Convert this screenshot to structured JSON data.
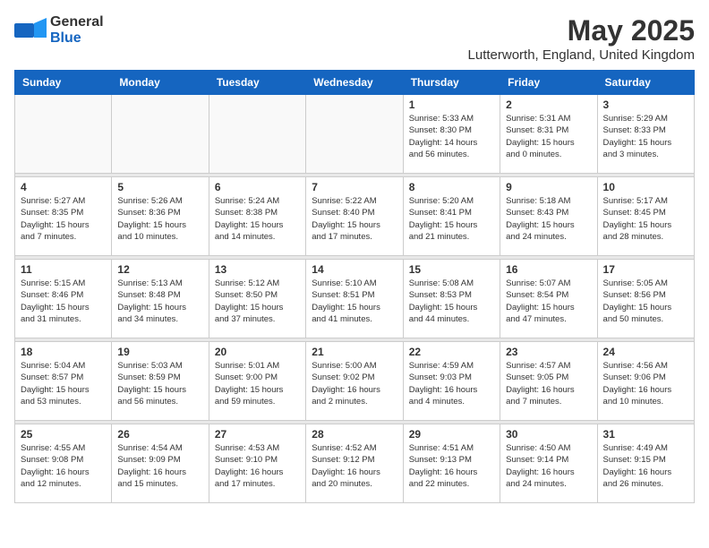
{
  "logo": {
    "line1": "General",
    "line2": "Blue"
  },
  "header": {
    "title": "May 2025",
    "location": "Lutterworth, England, United Kingdom"
  },
  "weekdays": [
    "Sunday",
    "Monday",
    "Tuesday",
    "Wednesday",
    "Thursday",
    "Friday",
    "Saturday"
  ],
  "rows": [
    [
      {
        "day": "",
        "info": ""
      },
      {
        "day": "",
        "info": ""
      },
      {
        "day": "",
        "info": ""
      },
      {
        "day": "",
        "info": ""
      },
      {
        "day": "1",
        "info": "Sunrise: 5:33 AM\nSunset: 8:30 PM\nDaylight: 14 hours\nand 56 minutes."
      },
      {
        "day": "2",
        "info": "Sunrise: 5:31 AM\nSunset: 8:31 PM\nDaylight: 15 hours\nand 0 minutes."
      },
      {
        "day": "3",
        "info": "Sunrise: 5:29 AM\nSunset: 8:33 PM\nDaylight: 15 hours\nand 3 minutes."
      }
    ],
    [
      {
        "day": "4",
        "info": "Sunrise: 5:27 AM\nSunset: 8:35 PM\nDaylight: 15 hours\nand 7 minutes."
      },
      {
        "day": "5",
        "info": "Sunrise: 5:26 AM\nSunset: 8:36 PM\nDaylight: 15 hours\nand 10 minutes."
      },
      {
        "day": "6",
        "info": "Sunrise: 5:24 AM\nSunset: 8:38 PM\nDaylight: 15 hours\nand 14 minutes."
      },
      {
        "day": "7",
        "info": "Sunrise: 5:22 AM\nSunset: 8:40 PM\nDaylight: 15 hours\nand 17 minutes."
      },
      {
        "day": "8",
        "info": "Sunrise: 5:20 AM\nSunset: 8:41 PM\nDaylight: 15 hours\nand 21 minutes."
      },
      {
        "day": "9",
        "info": "Sunrise: 5:18 AM\nSunset: 8:43 PM\nDaylight: 15 hours\nand 24 minutes."
      },
      {
        "day": "10",
        "info": "Sunrise: 5:17 AM\nSunset: 8:45 PM\nDaylight: 15 hours\nand 28 minutes."
      }
    ],
    [
      {
        "day": "11",
        "info": "Sunrise: 5:15 AM\nSunset: 8:46 PM\nDaylight: 15 hours\nand 31 minutes."
      },
      {
        "day": "12",
        "info": "Sunrise: 5:13 AM\nSunset: 8:48 PM\nDaylight: 15 hours\nand 34 minutes."
      },
      {
        "day": "13",
        "info": "Sunrise: 5:12 AM\nSunset: 8:50 PM\nDaylight: 15 hours\nand 37 minutes."
      },
      {
        "day": "14",
        "info": "Sunrise: 5:10 AM\nSunset: 8:51 PM\nDaylight: 15 hours\nand 41 minutes."
      },
      {
        "day": "15",
        "info": "Sunrise: 5:08 AM\nSunset: 8:53 PM\nDaylight: 15 hours\nand 44 minutes."
      },
      {
        "day": "16",
        "info": "Sunrise: 5:07 AM\nSunset: 8:54 PM\nDaylight: 15 hours\nand 47 minutes."
      },
      {
        "day": "17",
        "info": "Sunrise: 5:05 AM\nSunset: 8:56 PM\nDaylight: 15 hours\nand 50 minutes."
      }
    ],
    [
      {
        "day": "18",
        "info": "Sunrise: 5:04 AM\nSunset: 8:57 PM\nDaylight: 15 hours\nand 53 minutes."
      },
      {
        "day": "19",
        "info": "Sunrise: 5:03 AM\nSunset: 8:59 PM\nDaylight: 15 hours\nand 56 minutes."
      },
      {
        "day": "20",
        "info": "Sunrise: 5:01 AM\nSunset: 9:00 PM\nDaylight: 15 hours\nand 59 minutes."
      },
      {
        "day": "21",
        "info": "Sunrise: 5:00 AM\nSunset: 9:02 PM\nDaylight: 16 hours\nand 2 minutes."
      },
      {
        "day": "22",
        "info": "Sunrise: 4:59 AM\nSunset: 9:03 PM\nDaylight: 16 hours\nand 4 minutes."
      },
      {
        "day": "23",
        "info": "Sunrise: 4:57 AM\nSunset: 9:05 PM\nDaylight: 16 hours\nand 7 minutes."
      },
      {
        "day": "24",
        "info": "Sunrise: 4:56 AM\nSunset: 9:06 PM\nDaylight: 16 hours\nand 10 minutes."
      }
    ],
    [
      {
        "day": "25",
        "info": "Sunrise: 4:55 AM\nSunset: 9:08 PM\nDaylight: 16 hours\nand 12 minutes."
      },
      {
        "day": "26",
        "info": "Sunrise: 4:54 AM\nSunset: 9:09 PM\nDaylight: 16 hours\nand 15 minutes."
      },
      {
        "day": "27",
        "info": "Sunrise: 4:53 AM\nSunset: 9:10 PM\nDaylight: 16 hours\nand 17 minutes."
      },
      {
        "day": "28",
        "info": "Sunrise: 4:52 AM\nSunset: 9:12 PM\nDaylight: 16 hours\nand 20 minutes."
      },
      {
        "day": "29",
        "info": "Sunrise: 4:51 AM\nSunset: 9:13 PM\nDaylight: 16 hours\nand 22 minutes."
      },
      {
        "day": "30",
        "info": "Sunrise: 4:50 AM\nSunset: 9:14 PM\nDaylight: 16 hours\nand 24 minutes."
      },
      {
        "day": "31",
        "info": "Sunrise: 4:49 AM\nSunset: 9:15 PM\nDaylight: 16 hours\nand 26 minutes."
      }
    ]
  ]
}
